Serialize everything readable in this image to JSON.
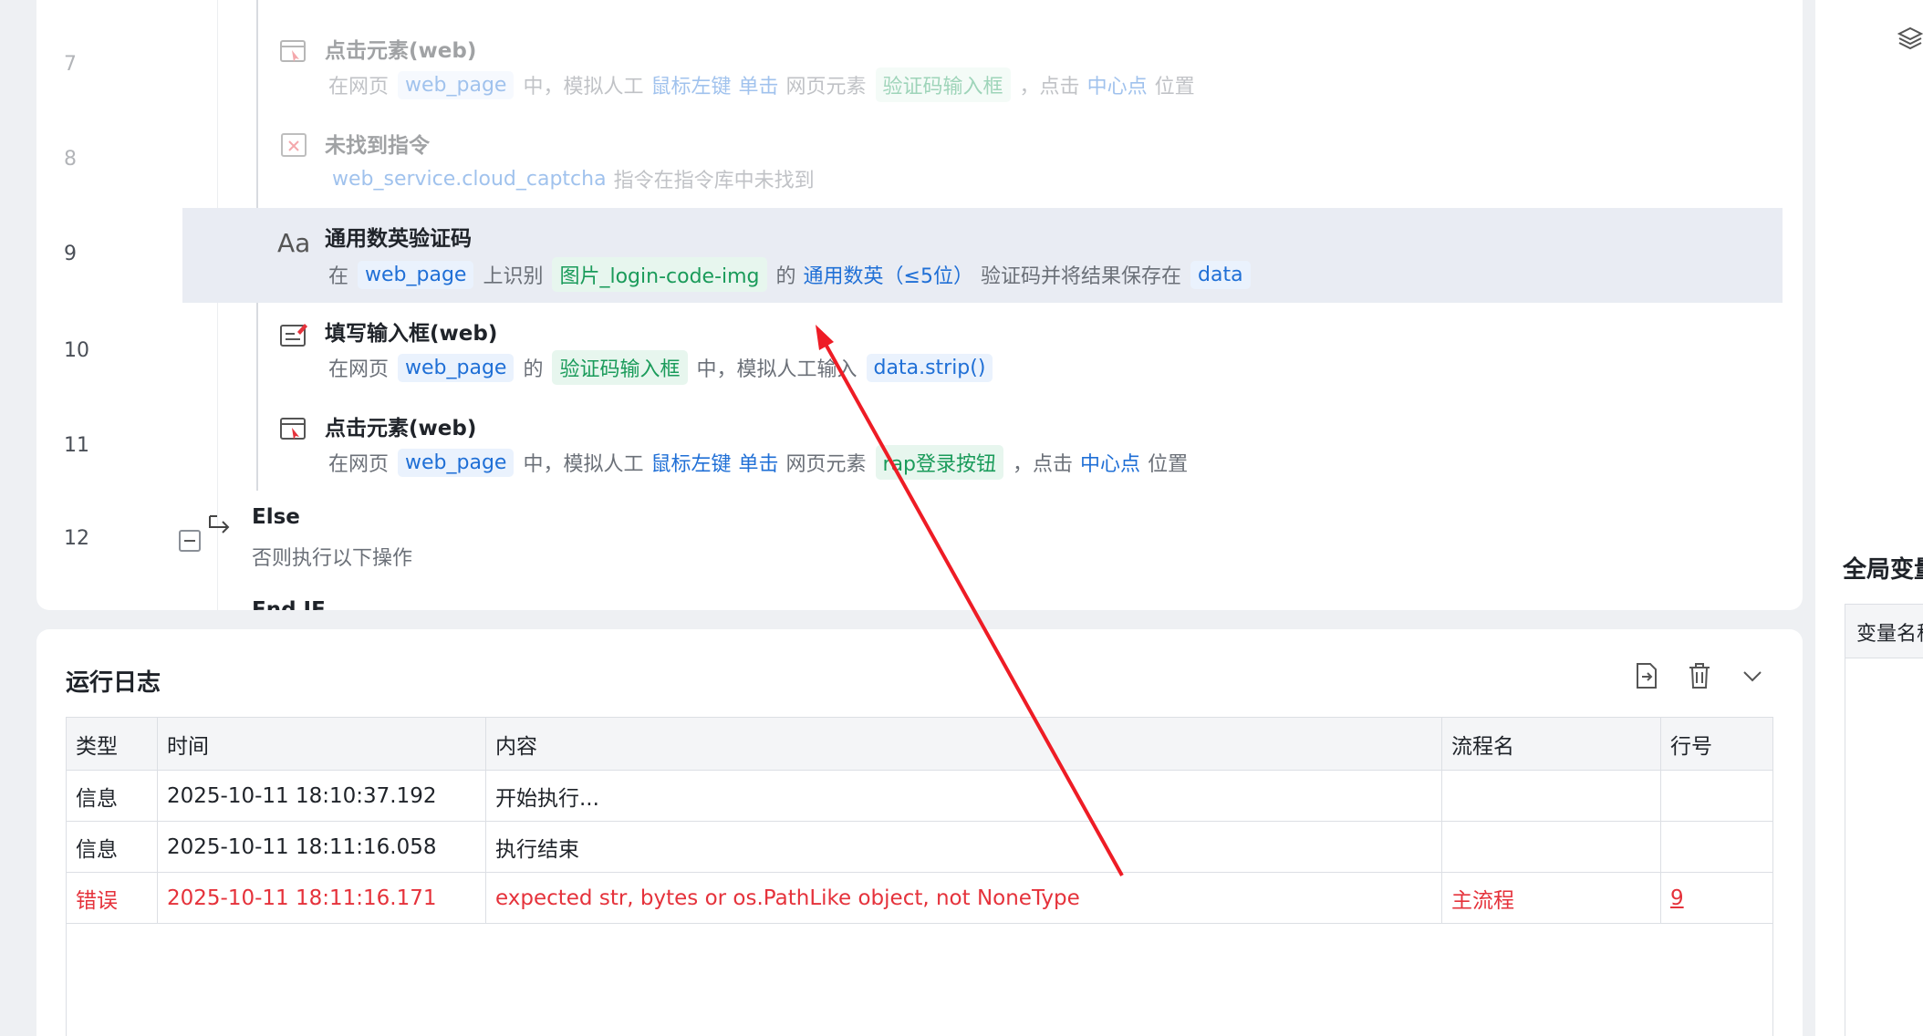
{
  "flow": {
    "rows": [
      {
        "line": "7",
        "title": "点击元素(web)",
        "faded": true,
        "desc": [
          {
            "t": "txt",
            "v": "在网页"
          },
          {
            "t": "chip-blue",
            "v": "web_page"
          },
          {
            "t": "txt",
            "v": "中，模拟人工"
          },
          {
            "t": "kw",
            "v": "鼠标左键"
          },
          {
            "t": "kw",
            "v": "单击"
          },
          {
            "t": "txt",
            "v": "网页元素"
          },
          {
            "t": "chip-green",
            "v": "验证码输入框"
          },
          {
            "t": "txt",
            "v": "，点击"
          },
          {
            "t": "kw",
            "v": "中心点"
          },
          {
            "t": "txt",
            "v": "位置"
          }
        ]
      },
      {
        "line": "8",
        "title": "未找到指令",
        "faded": true,
        "desc": [
          {
            "t": "kw",
            "v": "web_service.cloud_captcha"
          },
          {
            "t": "txt",
            "v": "指令在指令库中未找到"
          }
        ]
      },
      {
        "line": "9",
        "title": "通用数英验证码",
        "faded": false,
        "desc": [
          {
            "t": "txt",
            "v": "在"
          },
          {
            "t": "chip-blue",
            "v": "web_page"
          },
          {
            "t": "txt",
            "v": "上识别"
          },
          {
            "t": "chip-green",
            "v": "图片_login-code-img"
          },
          {
            "t": "txt",
            "v": "的"
          },
          {
            "t": "kw",
            "v": "通用数英（≤5位）"
          },
          {
            "t": "txt",
            "v": "验证码并将结果保存在"
          },
          {
            "t": "chip-blue",
            "v": "data"
          }
        ]
      },
      {
        "line": "10",
        "title": "填写输入框(web)",
        "faded": false,
        "desc": [
          {
            "t": "txt",
            "v": "在网页"
          },
          {
            "t": "chip-blue",
            "v": "web_page"
          },
          {
            "t": "txt",
            "v": "的"
          },
          {
            "t": "chip-green",
            "v": "验证码输入框"
          },
          {
            "t": "txt",
            "v": "中，模拟人工输入"
          },
          {
            "t": "chip-blue",
            "v": "data.strip()"
          }
        ]
      },
      {
        "line": "11",
        "title": "点击元素(web)",
        "faded": false,
        "desc": [
          {
            "t": "txt",
            "v": "在网页"
          },
          {
            "t": "chip-blue",
            "v": "web_page"
          },
          {
            "t": "txt",
            "v": "中，模拟人工"
          },
          {
            "t": "kw",
            "v": "鼠标左键"
          },
          {
            "t": "kw",
            "v": "单击"
          },
          {
            "t": "txt",
            "v": "网页元素"
          },
          {
            "t": "chip-green",
            "v": "rap登录按钮"
          },
          {
            "t": "txt",
            "v": "，点击"
          },
          {
            "t": "kw",
            "v": "中心点"
          },
          {
            "t": "txt",
            "v": "位置"
          }
        ]
      }
    ],
    "else_row": {
      "line": "12",
      "title": "Else",
      "desc": "否则执行以下操作"
    },
    "partial_next": "End IF"
  },
  "log": {
    "title": "运行日志",
    "columns": [
      "类型",
      "时间",
      "内容",
      "流程名",
      "行号"
    ],
    "rows": [
      {
        "type": "信息",
        "time": "2025-10-11 18:10:37.192",
        "content": "开始执行...",
        "flow": "",
        "line": "",
        "error": false
      },
      {
        "type": "信息",
        "time": "2025-10-11 18:11:16.058",
        "content": "执行结束",
        "flow": "",
        "line": "",
        "error": false
      },
      {
        "type": "错误",
        "time": "2025-10-11 18:11:16.171",
        "content": "expected str, bytes or os.PathLike object, not NoneType",
        "flow": "主流程",
        "line": "9",
        "error": true
      }
    ]
  },
  "right_panel": {
    "title": "全局变量",
    "column": "变量名称"
  },
  "colors": {
    "accent": "#1f6fd6",
    "success": "#1a9b5a",
    "error": "#e5323b",
    "highlight": "#e9ecf3",
    "annotation_arrow": "#ee1c25"
  }
}
